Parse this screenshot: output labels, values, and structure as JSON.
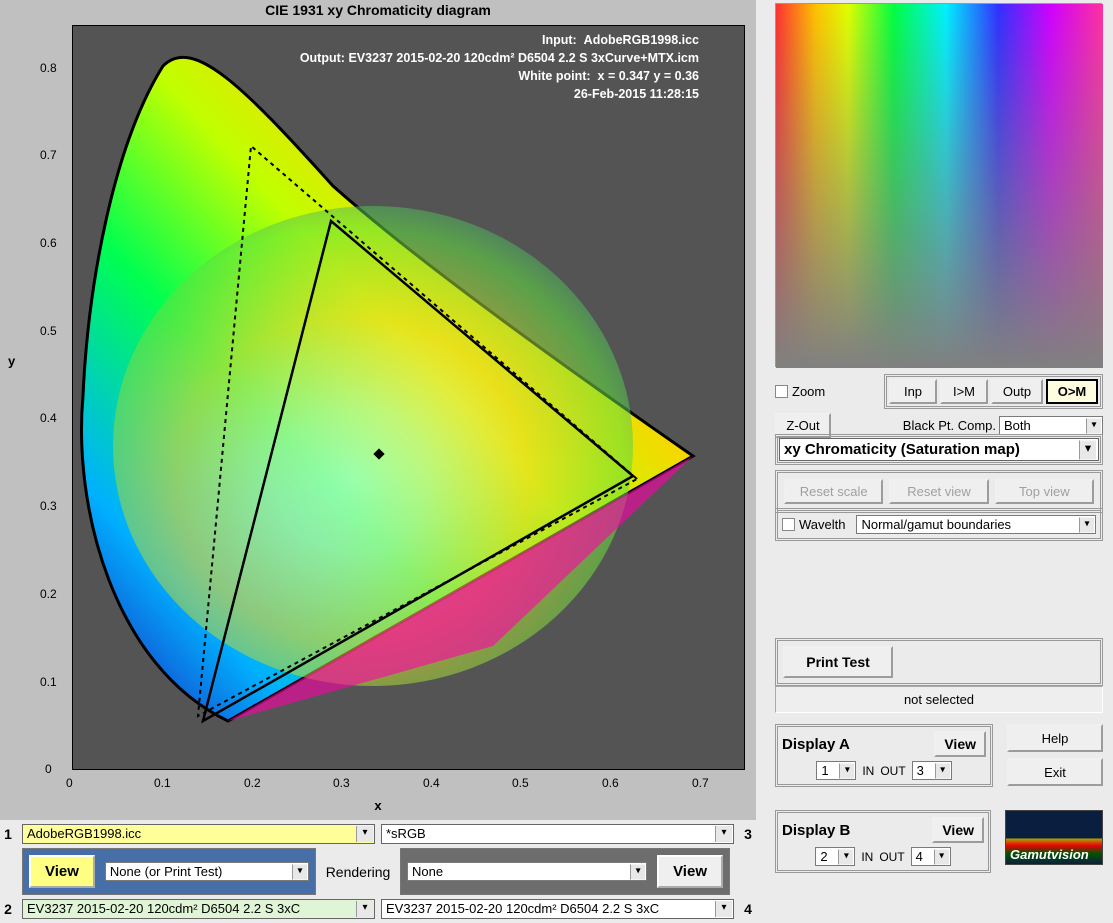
{
  "chart": {
    "title": "CIE 1931 xy Chromaticity diagram",
    "xlabel": "x",
    "ylabel": "y",
    "info": {
      "input_label": "Input:",
      "input": "AdobeRGB1998.icc",
      "output_label": "Output:",
      "output": "EV3237 2015-02-20 120cdm² D6504 2.2 S 3xCurve+MTX.icm",
      "wp_label": "White point:",
      "wp": "x = 0.347  y = 0.36",
      "date": "26-Feb-2015 11:28:15"
    },
    "ticks_x": [
      "0",
      "0.1",
      "0.2",
      "0.3",
      "0.4",
      "0.5",
      "0.6",
      "0.7"
    ],
    "ticks_y": [
      "0",
      "0.1",
      "0.2",
      "0.3",
      "0.4",
      "0.5",
      "0.6",
      "0.7",
      "0.8"
    ]
  },
  "chart_data": {
    "type": "xy-chromaticity",
    "title": "CIE 1931 xy Chromaticity diagram",
    "xlabel": "x",
    "ylabel": "y",
    "xlim": [
      0,
      0.75
    ],
    "ylim": [
      0,
      0.85
    ],
    "white_point": {
      "x": 0.347,
      "y": 0.36
    },
    "gamuts": [
      {
        "name": "Input (AdobeRGB1998.icc)",
        "style": "dotted",
        "vertices": [
          {
            "x": 0.64,
            "y": 0.33
          },
          {
            "x": 0.21,
            "y": 0.71
          },
          {
            "x": 0.15,
            "y": 0.06
          }
        ]
      },
      {
        "name": "Output (EV3237 mapped)",
        "style": "solid",
        "vertices": [
          {
            "x": 0.635,
            "y": 0.335
          },
          {
            "x": 0.3,
            "y": 0.625
          },
          {
            "x": 0.155,
            "y": 0.055
          }
        ]
      }
    ],
    "spectral_locus": true
  },
  "controls": {
    "zoom": "Zoom",
    "zout": "Z-Out",
    "inp": "Inp",
    "im": "I>M",
    "outp": "Outp",
    "om": "O>M",
    "blackpt_label": "Black Pt. Comp.",
    "blackpt": "Both",
    "plot_mode": "xy Chromaticity (Saturation map)",
    "reset_scale": "Reset scale",
    "reset_view": "Reset view",
    "top_view": "Top view",
    "wavelth": "Wavelth",
    "boundaries": "Normal/gamut boundaries",
    "print_test": "Print Test",
    "not_selected": "not selected",
    "display_a": "Display A",
    "display_b": "Display B",
    "view": "View",
    "in": "IN",
    "out": "OUT",
    "a_in": "1",
    "a_out": "3",
    "b_in": "2",
    "b_out": "4",
    "help": "Help",
    "exit": "Exit",
    "logo": "Gamutvision"
  },
  "bottom": {
    "profile1": "AdobeRGB1998.icc",
    "profile2": "EV3237 2015-02-20 120cdm² D6504 2.2 S 3xC",
    "profile3": "*sRGB",
    "profile4": "EV3237 2015-02-20 120cdm² D6504 2.2 S 3xC",
    "view": "View",
    "none_pt": "None (or Print Test)",
    "rendering": "Rendering",
    "none": "None",
    "n1": "1",
    "n2": "2",
    "n3": "3",
    "n4": "4"
  }
}
